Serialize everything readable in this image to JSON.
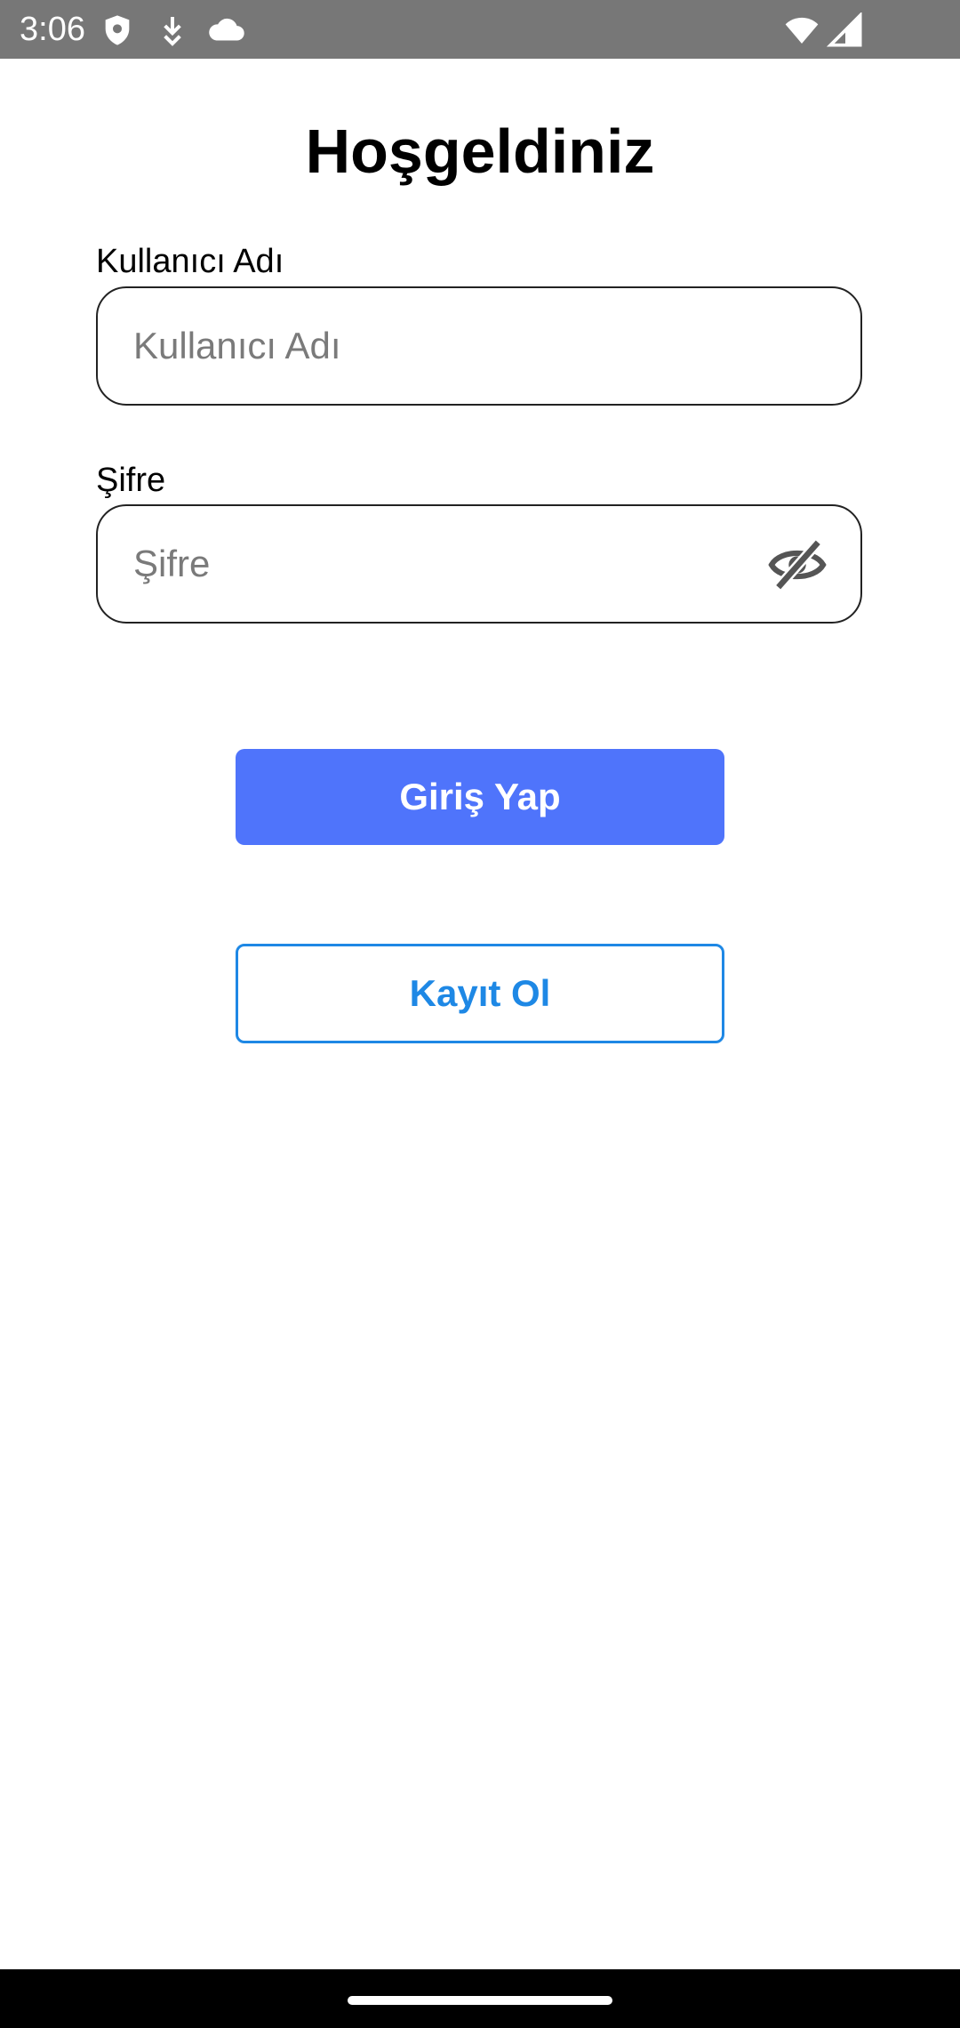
{
  "status_bar": {
    "time": "3:06",
    "icons": [
      "shield-icon",
      "download-icon",
      "cloud-icon",
      "wifi-icon",
      "cell-signal-icon"
    ]
  },
  "screen": {
    "title": "Hoşgeldiniz"
  },
  "form": {
    "username": {
      "label": "Kullanıcı Adı",
      "placeholder": "Kullanıcı Adı",
      "value": ""
    },
    "password": {
      "label": "Şifre",
      "placeholder": "Şifre",
      "value": "",
      "visibility_icon": "eye-off-icon"
    }
  },
  "actions": {
    "login_label": "Giriş Yap",
    "register_label": "Kayıt Ol"
  },
  "colors": {
    "status_bar": "#777777",
    "primary_button": "#4f74fb",
    "outline_button": "#1e88e5"
  }
}
